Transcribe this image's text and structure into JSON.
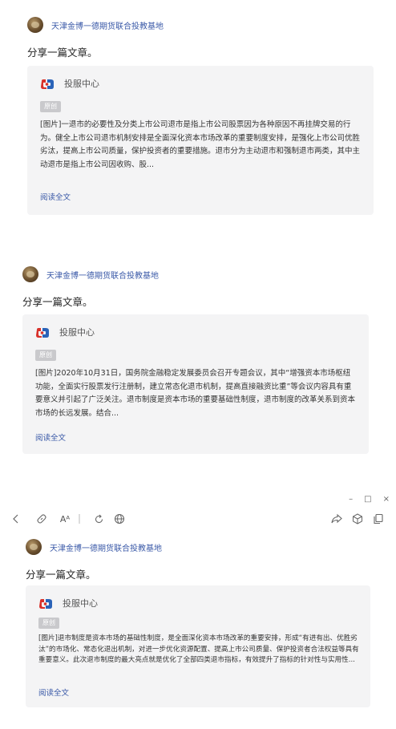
{
  "posts": [
    {
      "author": "天津金博一德期货联合投教基地",
      "text": "分享一篇文章。",
      "card": {
        "source": "投服中心",
        "badge": "原创",
        "excerpt": "[图片]一退市的必要性及分类上市公司退市是指上市公司股票因为各种原因不再挂牌交易的行为。健全上市公司退市机制安排是全面深化资本市场改革的重要制度安排，是强化上市公司优胜劣汰，提高上市公司质量，保护投资者的重要措施。退市分为主动退市和强制退市两类，其中主动退市是指上市公司因收购、股...",
        "read_more": "阅读全文"
      }
    },
    {
      "author": "天津金博一德期货联合投教基地",
      "text": "分享一篇文章。",
      "card": {
        "source": "投服中心",
        "badge": "原创",
        "excerpt": "[图片]2020年10月31日，国务院金融稳定发展委员会召开专题会议，其中“增强资本市场枢纽功能，全面实行股票发行注册制，建立常态化退市机制，提高直接融资比重”等会议内容具有重要意义并引起了广泛关注。退市制度是资本市场的重要基础性制度，退市制度的改革关系到资本市场的长远发展。结合...",
        "read_more": "阅读全文"
      }
    },
    {
      "author": "天津金博一德期货联合投教基地",
      "text": "分享一篇文章。",
      "card": {
        "source": "投服中心",
        "badge": "原创",
        "excerpt": "[图片]退市制度是资本市场的基础性制度，是全面深化资本市场改革的重要安排，形成“有进有出、优胜劣汰”的市场化、常态化退出机制，对进一步优化资源配置、提高上市公司质量、保护投资者合法权益等具有重要意义。此次退市制度的最大亮点就是优化了全部四类退市指标，有效提升了指标的针对性与实用性...",
        "read_more": "阅读全文"
      }
    }
  ],
  "toolbar": {
    "icons": [
      "back-icon",
      "link-icon",
      "font-size-icon",
      "refresh-icon",
      "globe-icon",
      "share-icon",
      "cube-icon",
      "copy-icon"
    ],
    "font_label": "Aᴬ"
  },
  "window_controls": {
    "minimize": "–",
    "maximize": "□",
    "close": "×"
  },
  "colors": {
    "link": "#3b5aa8",
    "card_bg": "#f4f4f5",
    "badge_bg": "#c9c9cc",
    "logo_red": "#d8312a",
    "logo_blue": "#2a63b8"
  }
}
